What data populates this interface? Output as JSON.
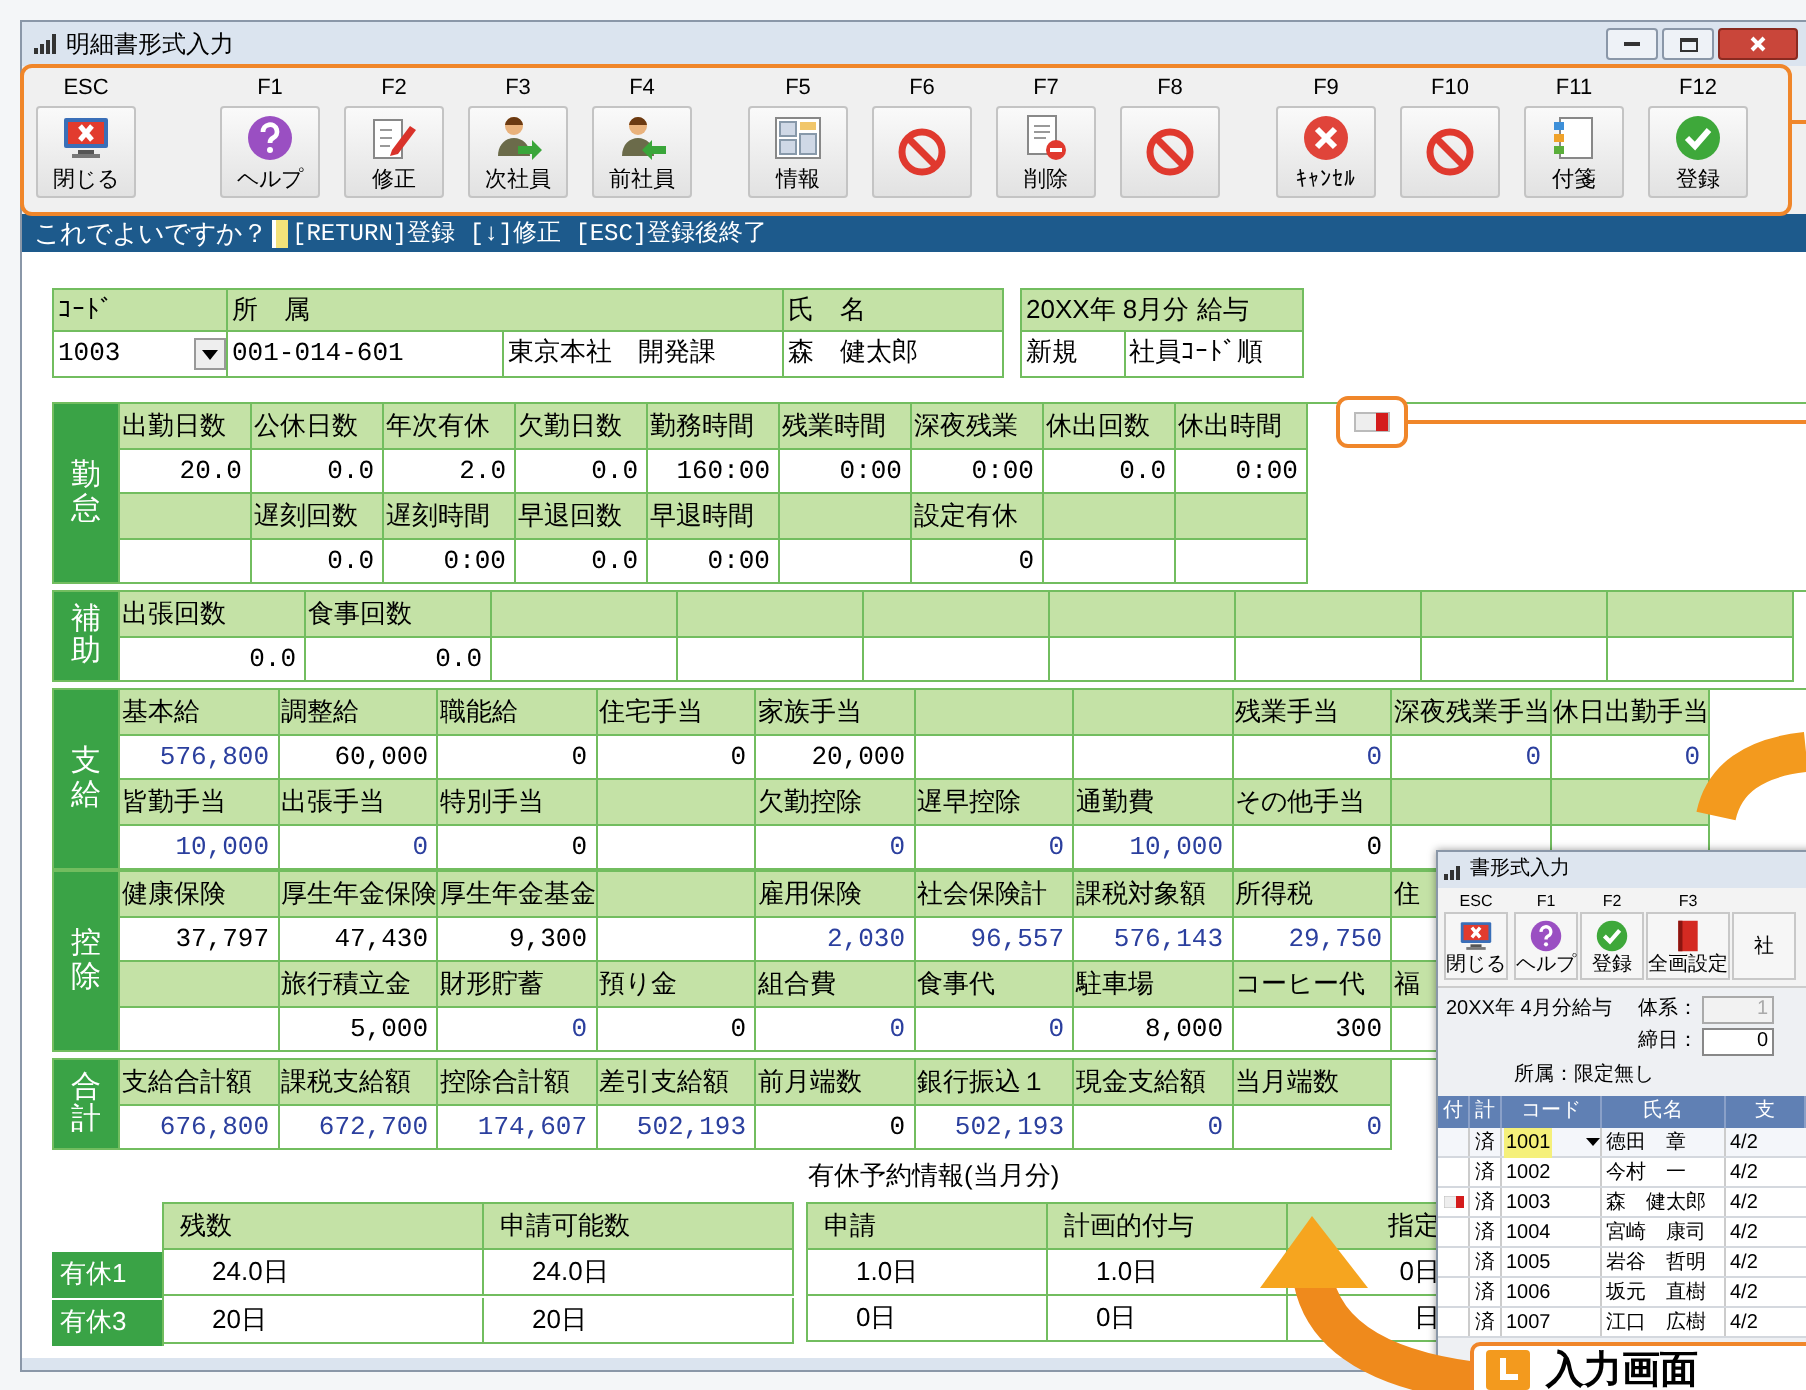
{
  "window": {
    "title": "明細書形式入力"
  },
  "toolbar": [
    [
      {
        "key": "ESC",
        "label": "閉じる"
      }
    ],
    [
      {
        "key": "F1",
        "label": "ヘルプ"
      },
      {
        "key": "F2",
        "label": "修正"
      },
      {
        "key": "F3",
        "label": "次社員"
      },
      {
        "key": "F4",
        "label": "前社員"
      }
    ],
    [
      {
        "key": "F5",
        "label": "情報"
      },
      {
        "key": "F6"
      },
      {
        "key": "F7",
        "label": "削除"
      },
      {
        "key": "F8"
      }
    ],
    [
      {
        "key": "F9",
        "label": "ｷｬﾝｾﾙ"
      },
      {
        "key": "F10"
      },
      {
        "key": "F11",
        "label": "付箋"
      },
      {
        "key": "F12",
        "label": "登録"
      }
    ]
  ],
  "prompt": {
    "question": "これでよいですか？",
    "hints": "[RETURN]登録 [↓]修正 [ESC]登録後終了"
  },
  "header": {
    "code_label": "ｺｰﾄﾞ",
    "code": "1003",
    "dept_label": "所　属",
    "dept_code": "001-014-601",
    "dept_name": "東京本社　開発課",
    "name_label": "氏　名",
    "name": "森　健太郎",
    "period": "20XX年 8月分 給与",
    "mode": "新規",
    "order": "社員ｺｰﾄﾞ順"
  },
  "sections": [
    {
      "label": "勤怠",
      "kind": "attendance",
      "rows": [
        [
          {
            "h": "出勤日数",
            "v": "20.0"
          },
          {
            "h": "公休日数",
            "v": "0.0"
          },
          {
            "h": "年次有休",
            "v": "2.0"
          },
          {
            "h": "欠勤日数",
            "v": "0.0"
          },
          {
            "h": "勤務時間",
            "v": "160:00"
          },
          {
            "h": "残業時間",
            "v": "0:00"
          },
          {
            "h": "深夜残業",
            "v": "0:00"
          },
          {
            "h": "休出回数",
            "v": "0.0"
          },
          {
            "h": "休出時間",
            "v": "0:00"
          }
        ],
        [
          {},
          {
            "h": "遅刻回数",
            "v": "0.0"
          },
          {
            "h": "遅刻時間",
            "v": "0:00"
          },
          {
            "h": "早退回数",
            "v": "0.0"
          },
          {
            "h": "早退時間",
            "v": "0:00"
          },
          {},
          {
            "h": "設定有休",
            "v": "0"
          },
          {},
          {}
        ]
      ]
    },
    {
      "label": "補助",
      "kind": "aux",
      "rows": [
        [
          {
            "h": "出張回数",
            "v": "0.0"
          },
          {
            "h": "食事回数",
            "v": "0.0"
          },
          {},
          {},
          {},
          {},
          {},
          {},
          {}
        ]
      ]
    },
    {
      "label": "支給",
      "kind": "pay",
      "rows": [
        [
          {
            "h": "基本給",
            "v": "576,800",
            "calc": true
          },
          {
            "h": "調整給",
            "v": "60,000",
            "calc": false
          },
          {
            "h": "職能給",
            "v": "0",
            "calc": false
          },
          {
            "h": "住宅手当",
            "v": "0",
            "calc": false
          },
          {
            "h": "家族手当",
            "v": "20,000",
            "calc": false
          },
          {},
          {},
          {
            "h": "残業手当",
            "v": "0",
            "calc": true
          },
          {
            "h": "深夜残業手当",
            "v": "0",
            "calc": true
          },
          {
            "h": "休日出勤手当",
            "v": "0",
            "calc": true
          }
        ],
        [
          {
            "h": "皆勤手当",
            "v": "10,000",
            "calc": true
          },
          {
            "h": "出張手当",
            "v": "0",
            "calc": true
          },
          {
            "h": "特別手当",
            "v": "0",
            "calc": false
          },
          {},
          {
            "h": "欠勤控除",
            "v": "0",
            "calc": true
          },
          {
            "h": "遅早控除",
            "v": "0",
            "calc": true
          },
          {
            "h": "通勤費",
            "v": "10,000",
            "calc": true
          },
          {
            "h": "その他手当",
            "v": "0",
            "calc": false
          },
          {},
          {}
        ]
      ]
    },
    {
      "label": "控除",
      "kind": "pay",
      "rows": [
        [
          {
            "h": "健康保険",
            "v": "37,797",
            "calc": false
          },
          {
            "h": "厚生年金保険",
            "v": "47,430",
            "calc": false
          },
          {
            "h": "厚生年金基金",
            "v": "9,300",
            "calc": false
          },
          {},
          {
            "h": "雇用保険",
            "v": "2,030",
            "calc": true
          },
          {
            "h": "社会保険計",
            "v": "96,557",
            "calc": true
          },
          {
            "h": "課税対象額",
            "v": "576,143",
            "calc": true
          },
          {
            "h": "所得税",
            "v": "29,750",
            "calc": true
          },
          {
            "h": "住"
          }
        ],
        [
          {},
          {
            "h": "旅行積立金",
            "v": "5,000",
            "calc": false
          },
          {
            "h": "財形貯蓄",
            "v": "0",
            "calc": true
          },
          {
            "h": "預り金",
            "v": "0",
            "calc": false
          },
          {
            "h": "組合費",
            "v": "0",
            "calc": true
          },
          {
            "h": "食事代",
            "v": "0",
            "calc": true
          },
          {
            "h": "駐車場",
            "v": "8,000",
            "calc": false
          },
          {
            "h": "コーヒー代",
            "v": "300",
            "calc": false
          },
          {
            "h": "福"
          }
        ]
      ]
    },
    {
      "label": "合計",
      "kind": "pay",
      "rows": [
        [
          {
            "h": "支給合計額",
            "v": "676,800",
            "calc": true
          },
          {
            "h": "課税支給額",
            "v": "672,700",
            "calc": true
          },
          {
            "h": "控除合計額",
            "v": "174,607",
            "calc": true
          },
          {
            "h": "差引支給額",
            "v": "502,193",
            "calc": true
          },
          {
            "h": "前月端数",
            "v": "0",
            "calc": false
          },
          {
            "h": "銀行振込１",
            "v": "502,193",
            "calc": true
          },
          {
            "h": "現金支給額",
            "v": "0",
            "calc": true
          },
          {
            "h": "当月端数",
            "v": "0",
            "calc": true
          }
        ]
      ]
    }
  ],
  "leave": {
    "title": "有休予約情報(当月分)",
    "left_columns": [
      "残数",
      "申請可能数"
    ],
    "right_columns": [
      "申請",
      "計画的付与",
      "指定"
    ],
    "rows": [
      {
        "label": "有休1",
        "left": [
          "24.0日",
          "24.0日"
        ],
        "right": [
          "1.0日",
          "1.0日",
          "0日"
        ]
      },
      {
        "label": "有休3",
        "left": [
          "20日",
          "20日"
        ],
        "right": [
          "0日",
          "0日",
          "日"
        ]
      }
    ]
  },
  "inset": {
    "title": "書形式入力",
    "toolbar": [
      {
        "key": "ESC",
        "label": "閉じる"
      },
      {
        "key": "F1",
        "label": "ヘルプ"
      },
      {
        "key": "F2",
        "label": "登録"
      },
      {
        "key": "F3",
        "label": "全画設定"
      },
      {
        "label": "社"
      }
    ],
    "period": "20XX年 4月分給与",
    "system_label": "体系：",
    "system_value": "1",
    "cutoff_label": "締日：",
    "cutoff_value": "0",
    "dept": "所属：限定無し",
    "columns": [
      "付",
      "計",
      "コード",
      "氏名",
      "支"
    ],
    "rows": [
      {
        "status": "済",
        "code": "1001",
        "name": "徳田　章",
        "date": "4/2",
        "selected": true,
        "flagged": false
      },
      {
        "status": "済",
        "code": "1002",
        "name": "今村　一",
        "date": "4/2",
        "selected": false,
        "flagged": false
      },
      {
        "status": "済",
        "code": "1003",
        "name": "森　健太郎",
        "date": "4/2",
        "selected": false,
        "flagged": true
      },
      {
        "status": "済",
        "code": "1004",
        "name": "宮崎　康司",
        "date": "4/2",
        "selected": false,
        "flagged": false
      },
      {
        "status": "済",
        "code": "1005",
        "name": "岩谷　哲明",
        "date": "4/2",
        "selected": false,
        "flagged": false
      },
      {
        "status": "済",
        "code": "1006",
        "name": "坂元　直樹",
        "date": "4/2",
        "selected": false,
        "flagged": false
      },
      {
        "status": "済",
        "code": "1007",
        "name": "江口　広樹",
        "date": "4/2",
        "selected": false,
        "flagged": false
      }
    ]
  },
  "banner": {
    "text": "入力画面"
  }
}
